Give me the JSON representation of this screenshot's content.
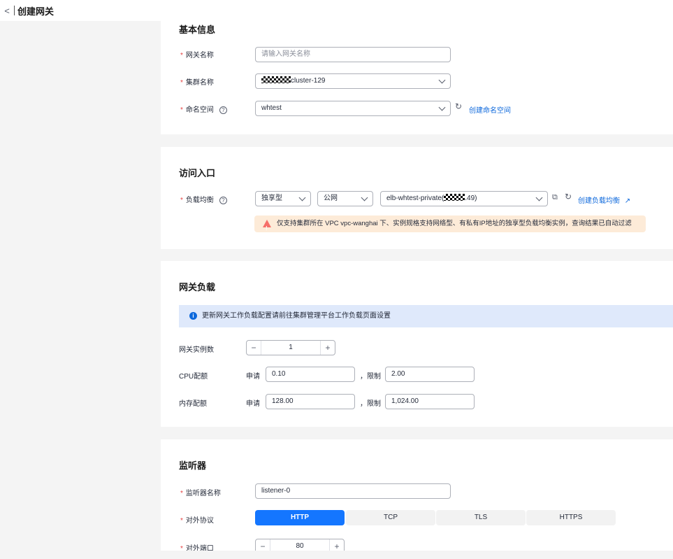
{
  "header": {
    "back_glyph": "<",
    "title": "创建网关"
  },
  "basic": {
    "title": "基本信息",
    "gateway_name_label": "网关名称",
    "gateway_name_placeholder": "请输入网关名称",
    "cluster_label": "集群名称",
    "cluster_value_suffix": "cluster-129",
    "namespace_label": "命名空间",
    "namespace_value": "whtest",
    "create_namespace_link": "创建命名空间"
  },
  "access": {
    "title": "访问入口",
    "lb_label": "负载均衡",
    "lb_type": "独享型",
    "network_type": "公网",
    "elb_prefix": "elb-whtest-private(",
    "elb_suffix": ".49)",
    "create_lb_link": "创建负载均衡",
    "warning": "仅支持集群所在 VPC vpc-wanghai 下、实例规格支持网络型、有私有IP地址的独享型负载均衡实例，查询结果已自动过滤"
  },
  "workload": {
    "title": "网关负载",
    "info": "更新网关工作负载配置请前往集群管理平台工作负载页面设置",
    "replicas_label": "网关实例数",
    "replicas_value": "1",
    "cpu_label": "CPU配额",
    "mem_label": "内存配额",
    "request_label": "申请",
    "limit_label": "，限制",
    "cpu_request": "0.10",
    "cpu_limit": "2.00",
    "mem_request": "128.00",
    "mem_limit": "1,024.00"
  },
  "listener": {
    "title": "监听器",
    "name_label": "监听器名称",
    "name_value": "listener-0",
    "protocol_label": "对外协议",
    "protocols": [
      "HTTP",
      "TCP",
      "TLS",
      "HTTPS"
    ],
    "active_protocol": "HTTP",
    "port_label": "对外端口",
    "port_value": "80"
  },
  "glyphs": {
    "minus": "−",
    "plus": "+",
    "refresh": "↻",
    "required": "*",
    "help": "?",
    "copy": "⧉",
    "external": "↗"
  },
  "colors": {
    "primary": "#1476ff",
    "link": "#0d68dc",
    "required": "#e54545",
    "warning_bg": "#fdebd8",
    "info_bg": "#dfe9fb"
  }
}
